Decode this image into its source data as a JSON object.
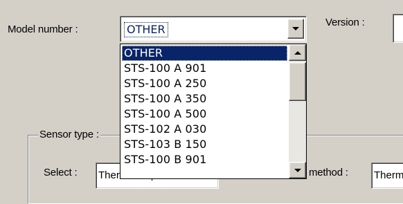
{
  "labels": {
    "model_number": "Model number :",
    "version": "Version :",
    "sensor_type": "Sensor type :",
    "select": "Select :",
    "method": "method :"
  },
  "model_combo": {
    "value": "OTHER",
    "options": [
      "OTHER",
      "STS-100 A 901",
      "STS-100 A 250",
      "STS-100 A 350",
      "STS-100 A 500",
      "STS-102 A 030",
      "STS-103 B 150",
      "STS-100 B 901"
    ],
    "selected_index": 0
  },
  "select_field": {
    "value": "Thermocouple"
  },
  "method_field": {
    "value": "Thermocouple"
  },
  "icons": {
    "dropdown_arrow": "chevron-down-icon",
    "scroll_up": "arrow-up-icon",
    "scroll_down": "arrow-down-icon"
  },
  "colors": {
    "face": "#d4d0c8",
    "highlight": "#0a246a",
    "field_text": "#0a246a"
  }
}
